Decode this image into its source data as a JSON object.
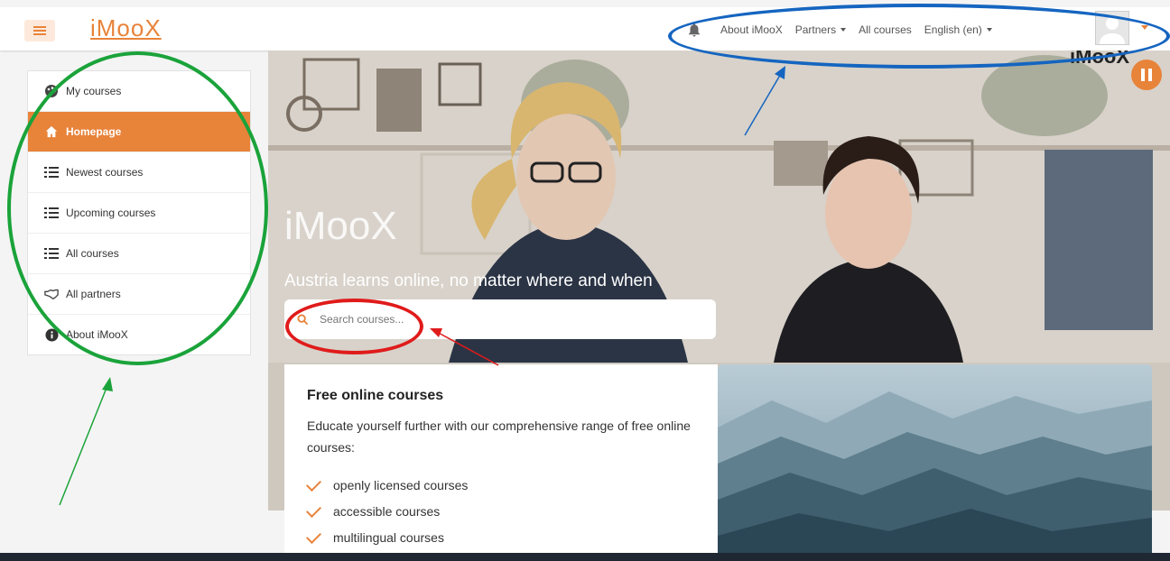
{
  "app": {
    "logo": "iMooX"
  },
  "header": {
    "nav": [
      {
        "label": "About iMooX",
        "dropdown": false
      },
      {
        "label": "Partners",
        "dropdown": true
      },
      {
        "label": "All courses",
        "dropdown": false
      },
      {
        "label": "English (en)",
        "dropdown": true
      }
    ]
  },
  "sidebar": {
    "items": [
      {
        "label": "My courses",
        "icon": "palette-icon",
        "active": false
      },
      {
        "label": "Homepage",
        "icon": "home-icon",
        "active": true
      },
      {
        "label": "Newest courses",
        "icon": "list-icon",
        "active": false
      },
      {
        "label": "Upcoming courses",
        "icon": "list-icon",
        "active": false
      },
      {
        "label": "All courses",
        "icon": "list-icon",
        "active": false
      },
      {
        "label": "All partners",
        "icon": "handshake-icon",
        "active": false
      },
      {
        "label": "About iMooX",
        "icon": "info-icon",
        "active": false
      }
    ]
  },
  "hero": {
    "title": "iMooX",
    "subtitle": "Austria learns online, no matter where and when",
    "corner_brand": "iMooX",
    "search_placeholder": "Search courses..."
  },
  "card": {
    "heading": "Free online courses",
    "description": "Educate yourself further with our comprehensive range of free online courses:",
    "features": [
      "openly licensed courses",
      "accessible courses",
      "multilingual courses"
    ]
  },
  "colors": {
    "accent": "#e8833a",
    "annotation_green": "#1aa33a",
    "annotation_blue": "#1565c0",
    "annotation_red": "#e01b1b"
  }
}
